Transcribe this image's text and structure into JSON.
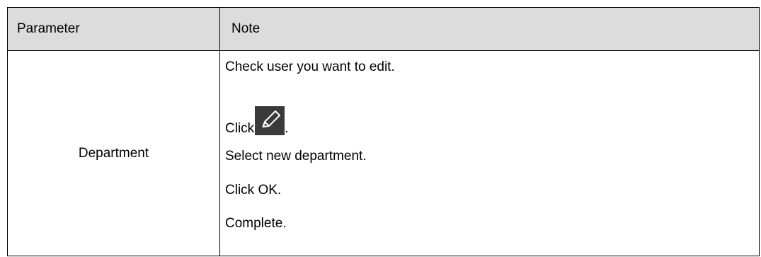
{
  "table": {
    "headers": {
      "parameter": "Parameter",
      "note": "Note"
    },
    "rows": [
      {
        "parameter": "Department",
        "note_lines": {
          "line1": "Check user you want to edit.",
          "line2_prefix": "Click",
          "line2_icon": "pencil-edit-icon",
          "line2_suffix": ".",
          "line3": "Select new department.",
          "line4": "Click OK.",
          "line5": "Complete."
        }
      }
    ]
  }
}
